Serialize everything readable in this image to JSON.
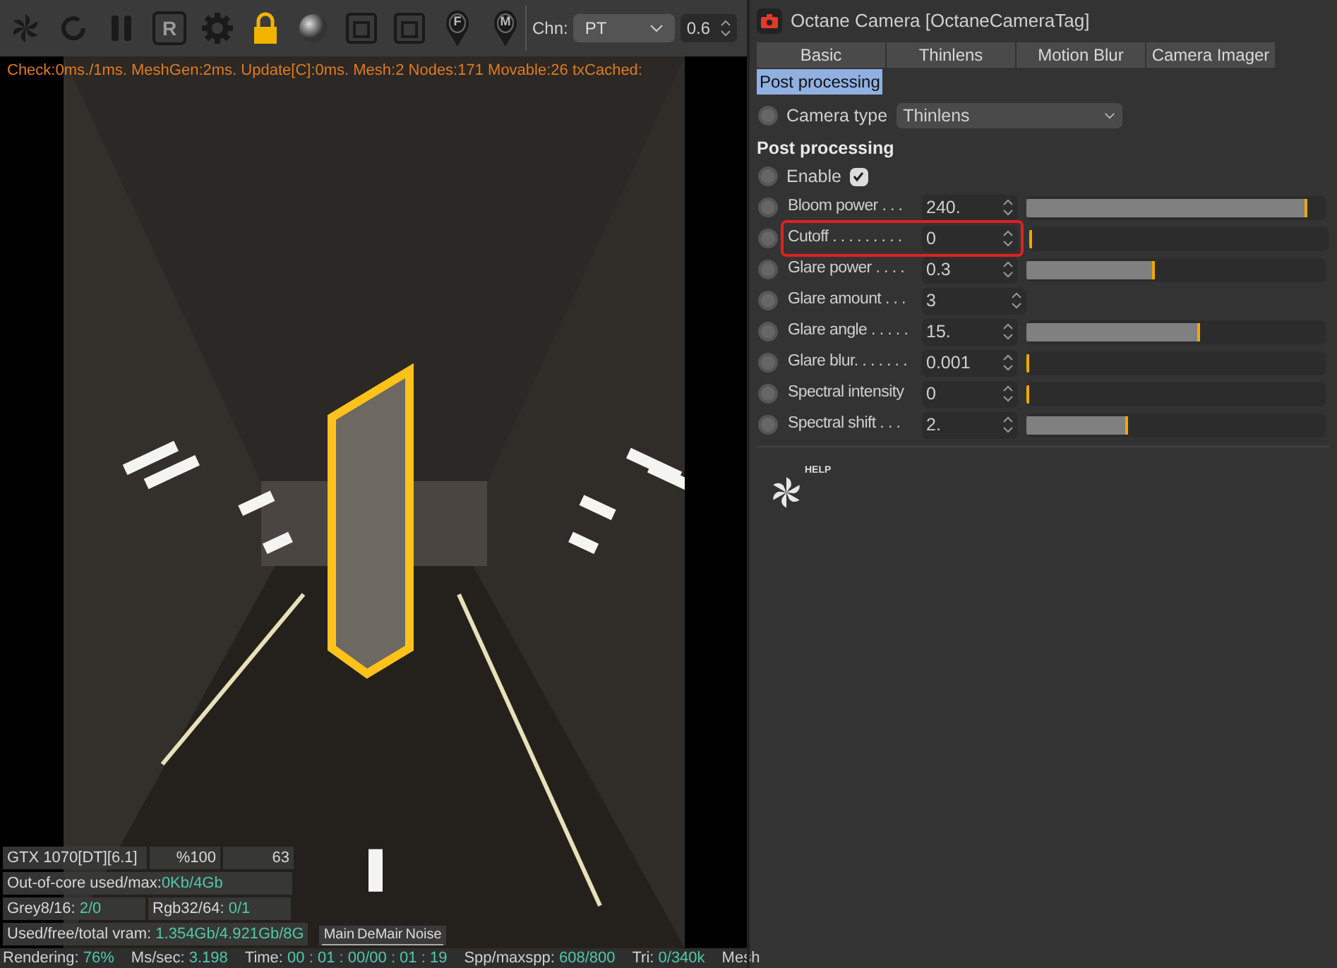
{
  "toolbar": {
    "tools": [
      {
        "kind": "logo"
      },
      {
        "kind": "refresh"
      },
      {
        "kind": "pause"
      },
      {
        "kind": "letter",
        "label": "R"
      },
      {
        "kind": "gear"
      },
      {
        "kind": "lock"
      },
      {
        "kind": "sphere"
      },
      {
        "kind": "region"
      },
      {
        "kind": "region"
      },
      {
        "kind": "pin",
        "label": "F"
      },
      {
        "kind": "pin",
        "label": "M"
      }
    ],
    "channel_label": "Chn:",
    "channel": "PT",
    "value": "0.6"
  },
  "log": "Check:0ms./1ms. MeshGen:2ms. Update[C]:0ms. Mesh:2 Nodes:171 Movable:26 txCached:",
  "overlay": {
    "rows": [
      [
        {
          "label": "GTX 1070[DT][6.1]"
        },
        {
          "label": "%100"
        },
        {
          "label": "63"
        }
      ],
      [
        {
          "label": "Out-of-core used/max:",
          "value": "0Kb/4Gb"
        }
      ],
      [
        {
          "label": "Grey8/16: ",
          "value": "2/0"
        },
        {
          "label": "Rgb32/64: ",
          "value": "0/1"
        }
      ],
      [
        {
          "label": "Used/free/total vram: ",
          "value": "1.354Gb/4.921Gb/8G"
        }
      ]
    ],
    "tabs": [
      {
        "label": "Main"
      },
      {
        "label": "DeMair"
      },
      {
        "label": "Noise"
      }
    ]
  },
  "status_bar": [
    {
      "label": "Rendering: ",
      "value": "76%"
    },
    {
      "label": "Ms/sec: ",
      "value": "3.198"
    },
    {
      "label": "Time: ",
      "value": "00 : 01 : 00/00 : 01 : 19"
    },
    {
      "label": "Spp/maxspp: ",
      "value": "608/800"
    },
    {
      "label": "Tri: ",
      "value": "0/340k"
    },
    {
      "label": "Mesh"
    }
  ],
  "panel": {
    "title": "Octane Camera [OctaneCameraTag]",
    "tabs": [
      {
        "label": "Basic",
        "selected": false
      },
      {
        "label": "Thinlens",
        "selected": false
      },
      {
        "label": "Motion Blur",
        "selected": false
      },
      {
        "label": "Camera Imager",
        "selected": false
      },
      {
        "label": "Post processing",
        "selected": true
      }
    ],
    "camera_type": {
      "label": "Camera type",
      "value": "Thinlens"
    },
    "section": "Post processing",
    "enable": {
      "label": "Enable",
      "checked": true
    },
    "params": [
      {
        "label": "Bloom power . . .",
        "value": "240.",
        "level": 0.93,
        "highlighted": false
      },
      {
        "label": "Cutoff . . . . . . . . .",
        "value": "0",
        "level": 0,
        "highlighted": true
      },
      {
        "label": "Glare power . . . .",
        "value": "0.3",
        "level": 0.42,
        "highlighted": false
      },
      {
        "label": "Glare amount . . .",
        "value": "3",
        "highlighted": false
      },
      {
        "label": "Glare angle . . . . .",
        "value": "15.",
        "level": 0.57,
        "highlighted": false
      },
      {
        "label": "Glare blur. . . . . . .",
        "value": "0.001",
        "level": 0,
        "highlighted": false
      },
      {
        "label": "Spectral intensity",
        "value": "0",
        "level": 0,
        "highlighted": false
      },
      {
        "label": "Spectral shift . . .",
        "value": "2.",
        "level": 0.33,
        "highlighted": false
      }
    ],
    "help": "HELP"
  }
}
